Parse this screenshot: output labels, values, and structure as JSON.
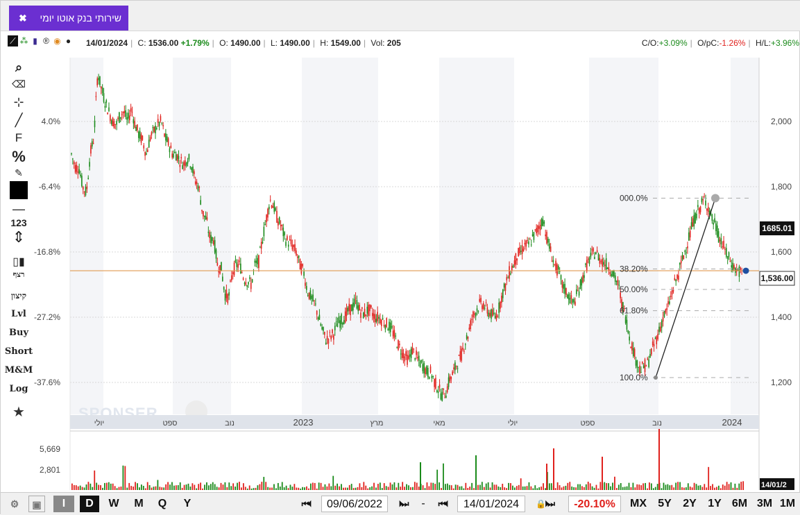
{
  "tab": {
    "title": "שירותי בנק אוטו יומי",
    "close": "✖"
  },
  "quote": {
    "date": "14/01/2024",
    "close_label": "C:",
    "close": "1536.00",
    "change": "+1.79%",
    "open_label": "O:",
    "open": "1490.00",
    "low_label": "L:",
    "low": "1490.00",
    "high_label": "H:",
    "high": "1549.00",
    "vol_label": "Vol:",
    "vol": "205",
    "co_label": "C/O:",
    "co": "+3.09%",
    "opc_label": "O/pC:",
    "opc": "-1.26%",
    "hl_label": "H/L:",
    "hl": "+3.96%"
  },
  "left_tools": {
    "format_label": "F",
    "percent_label": "%",
    "num_label": "123",
    "sequence_label": "רצף",
    "trend_label": "קיצון",
    "lvl_label": "Lvl",
    "buy_label": "Buy",
    "short_label": "Short",
    "mm_label": "M&M",
    "log_label": "Log"
  },
  "watermark": "SPONSER",
  "chart_data": {
    "type": "candlestick",
    "y_axis_right": {
      "ticks": [
        "2,000",
        "1,800",
        "1,600",
        "1,400",
        "1,200"
      ],
      "values": [
        2000,
        1800,
        1600,
        1400,
        1200
      ]
    },
    "y_axis_left": {
      "ticks": [
        "4.0%",
        "-6.4%",
        "-16.8%",
        "-27.2%",
        "-37.6%"
      ]
    },
    "x_axis": {
      "labels": [
        "יולי",
        "ספט",
        "נוב",
        "2023",
        "מרץ",
        "מאי",
        "יולי",
        "ספט",
        "נוב",
        "2024"
      ]
    },
    "current_price_label": "1,536.00",
    "hover_price_label": "1685.01",
    "horizontal_line_value": 1536,
    "fibonacci": {
      "labels": [
        "000.0%",
        "38.20%",
        "50.00%",
        "61.80%",
        "100.0%"
      ],
      "values": [
        1765,
        1548,
        1485,
        1420,
        1215
      ]
    },
    "volume_axis": {
      "ticks": [
        "5,669",
        "2,801"
      ]
    },
    "volume_date_label": "14/01/2",
    "price_path": [
      [
        1900,
        1860
      ],
      [
        1860,
        1800
      ],
      [
        1780,
        1900
      ],
      [
        1950,
        2150
      ],
      [
        2100,
        2060
      ],
      [
        2030,
        2000
      ],
      [
        1990,
        2020
      ],
      [
        2030,
        2000
      ],
      [
        2040,
        1990
      ],
      [
        1960,
        1940
      ],
      [
        1900,
        1950
      ],
      [
        1970,
        1990
      ],
      [
        2000,
        1950
      ],
      [
        1930,
        1900
      ],
      [
        1900,
        1880
      ],
      [
        1870,
        1890
      ],
      [
        1870,
        1820
      ],
      [
        1800,
        1720
      ],
      [
        1700,
        1640
      ],
      [
        1640,
        1560
      ],
      [
        1550,
        1470
      ],
      [
        1460,
        1540
      ],
      [
        1560,
        1560
      ],
      [
        1520,
        1510
      ],
      [
        1500,
        1560
      ],
      [
        1570,
        1640
      ],
      [
        1700,
        1760
      ],
      [
        1740,
        1700
      ],
      [
        1680,
        1640
      ],
      [
        1630,
        1620
      ],
      [
        1600,
        1560
      ],
      [
        1540,
        1480
      ],
      [
        1460,
        1440
      ],
      [
        1400,
        1360
      ],
      [
        1330,
        1340
      ],
      [
        1350,
        1380
      ],
      [
        1390,
        1400
      ],
      [
        1420,
        1430
      ],
      [
        1450,
        1420
      ],
      [
        1410,
        1420
      ],
      [
        1420,
        1400
      ],
      [
        1400,
        1390
      ],
      [
        1380,
        1370
      ],
      [
        1350,
        1320
      ],
      [
        1300,
        1280
      ],
      [
        1270,
        1300
      ],
      [
        1280,
        1260
      ],
      [
        1250,
        1230
      ],
      [
        1230,
        1200
      ],
      [
        1180,
        1160
      ],
      [
        1170,
        1210
      ],
      [
        1230,
        1260
      ],
      [
        1280,
        1320
      ],
      [
        1350,
        1400
      ],
      [
        1420,
        1440
      ],
      [
        1440,
        1420
      ],
      [
        1410,
        1400
      ],
      [
        1420,
        1470
      ],
      [
        1500,
        1540
      ],
      [
        1560,
        1590
      ],
      [
        1600,
        1620
      ],
      [
        1620,
        1640
      ],
      [
        1660,
        1680
      ],
      [
        1700,
        1640
      ],
      [
        1600,
        1560
      ],
      [
        1540,
        1500
      ],
      [
        1480,
        1460
      ],
      [
        1440,
        1470
      ],
      [
        1500,
        1540
      ],
      [
        1570,
        1590
      ],
      [
        1600,
        1580
      ],
      [
        1570,
        1560
      ],
      [
        1550,
        1520
      ],
      [
        1500,
        1440
      ],
      [
        1400,
        1340
      ],
      [
        1300,
        1260
      ],
      [
        1240,
        1250
      ],
      [
        1260,
        1300
      ],
      [
        1330,
        1360
      ],
      [
        1400,
        1420
      ],
      [
        1460,
        1500
      ],
      [
        1530,
        1570
      ],
      [
        1610,
        1650
      ],
      [
        1690,
        1720
      ],
      [
        1740,
        1760
      ],
      [
        1740,
        1700
      ],
      [
        1680,
        1640
      ],
      [
        1620,
        1590
      ],
      [
        1570,
        1550
      ],
      [
        1540,
        1536
      ]
    ]
  },
  "bottom_bar": {
    "interval_i": "I",
    "interval_d": "D",
    "interval_w": "W",
    "interval_m": "M",
    "interval_q": "Q",
    "interval_y": "Y",
    "start_date": "09/06/2022",
    "dash": "-",
    "end_date": "14/01/2024",
    "change": "-20.10%",
    "ranges": [
      "MX",
      "5Y",
      "2Y",
      "1Y",
      "6M",
      "3M",
      "1M"
    ]
  },
  "colors": {
    "accent": "#6b2fd1",
    "up": "#1a8a1a",
    "down": "#e0201c",
    "line": "#e09a50"
  }
}
